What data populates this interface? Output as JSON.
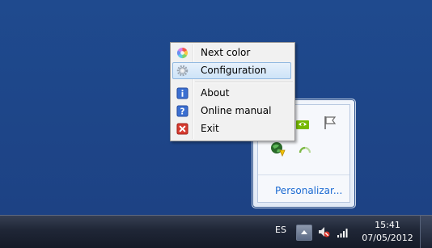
{
  "context_menu": {
    "items": [
      {
        "label": "Next color",
        "icon": "color-wheel-icon"
      },
      {
        "label": "Configuration",
        "icon": "gear-icon",
        "highlighted": true
      },
      {
        "label": "About",
        "icon": "info-icon"
      },
      {
        "label": "Online manual",
        "icon": "help-icon"
      },
      {
        "label": "Exit",
        "icon": "close-icon"
      }
    ]
  },
  "tray_flyout": {
    "customize_label": "Personalizar...",
    "icons": [
      "nvidia-icon",
      "flag-icon",
      "globe-icon",
      "spinner-icon"
    ]
  },
  "taskbar": {
    "language": "ES",
    "time": "15:41",
    "date": "07/05/2012"
  },
  "colors": {
    "desktop": "#1e4387",
    "menu_highlight": "#cde3f8",
    "link": "#1b6ad2"
  }
}
